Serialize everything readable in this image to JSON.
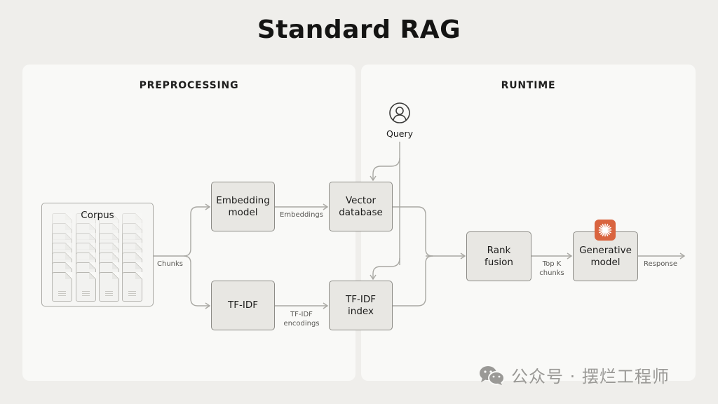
{
  "title": "Standard RAG",
  "sections": {
    "preprocessing": "PREPROCESSING",
    "runtime": "RUNTIME"
  },
  "nodes": {
    "corpus": "Corpus",
    "embedding_model": "Embedding\nmodel",
    "tfidf": "TF-IDF",
    "vector_database": "Vector\ndatabase",
    "tfidf_index": "TF-IDF\nindex",
    "rank_fusion": "Rank\nfusion",
    "generative_model": "Generative\nmodel",
    "query": "Query"
  },
  "edge_labels": {
    "chunks": "Chunks",
    "embeddings": "Embeddings",
    "tfidf_encodings": "TF-IDF\nencodings",
    "top_k_chunks": "Top K\nchunks",
    "response": "Response"
  },
  "icons": {
    "query": "user-circle-icon",
    "generative_model": "sparkle-burst-icon",
    "corpus": "document-stack-icon",
    "watermark": "wechat-icon"
  },
  "colors": {
    "background": "#efeeeb",
    "panel": "#f9f9f7",
    "node_fill": "#e8e7e3",
    "node_border": "#8d8c87",
    "wire": "#a9a8a3",
    "accent": "#d9643f"
  },
  "watermark": "公众号 · 摆烂工程师"
}
